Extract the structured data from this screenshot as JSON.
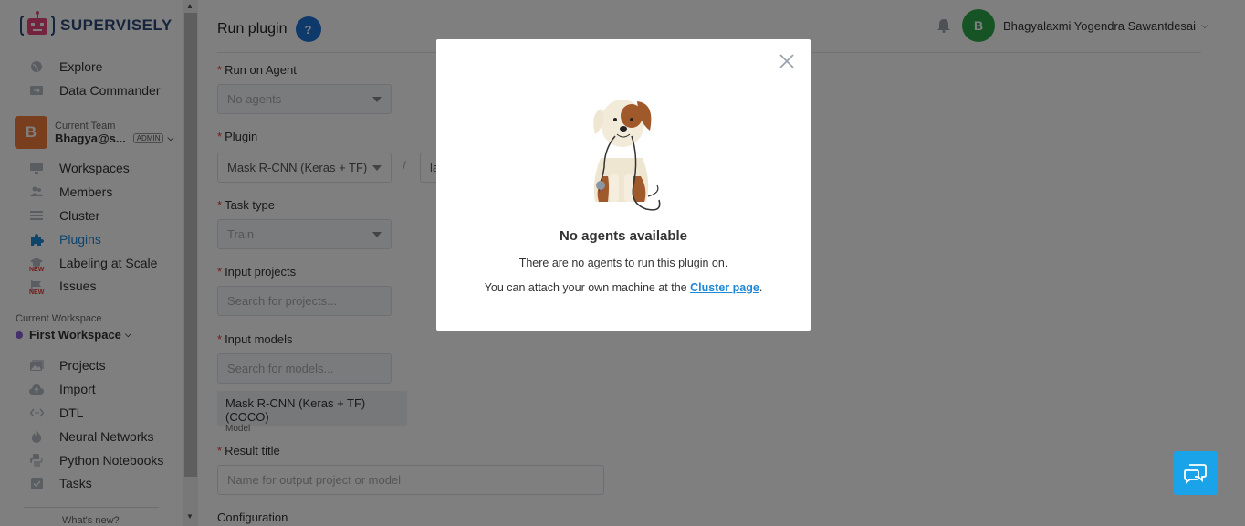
{
  "brand": {
    "name": "SUPERVISELY"
  },
  "sidebar": {
    "top_items": [
      {
        "label": "Explore",
        "icon": "globe-icon"
      },
      {
        "label": "Data Commander",
        "icon": "folder-transfer-icon"
      }
    ],
    "team": {
      "label": "Current Team",
      "name": "Bhagya@s...",
      "role": "ADMIN",
      "avatar_letter": "B"
    },
    "team_items": [
      {
        "label": "Workspaces",
        "icon": "monitor-icon"
      },
      {
        "label": "Members",
        "icon": "users-icon"
      },
      {
        "label": "Cluster",
        "icon": "list-icon"
      },
      {
        "label": "Plugins",
        "icon": "puzzle-icon",
        "active": true
      },
      {
        "label": "Labeling at Scale",
        "icon": "graduation-icon",
        "badge": "NEW"
      },
      {
        "label": "Issues",
        "icon": "flag-icon",
        "badge": "NEW"
      }
    ],
    "workspace": {
      "label": "Current Workspace",
      "name": "First Workspace"
    },
    "workspace_items": [
      {
        "label": "Projects",
        "icon": "images-icon"
      },
      {
        "label": "Import",
        "icon": "cloud-upload-icon"
      },
      {
        "label": "DTL",
        "icon": "code-icon"
      },
      {
        "label": "Neural Networks",
        "icon": "brain-icon"
      },
      {
        "label": "Python Notebooks",
        "icon": "notebook-icon"
      },
      {
        "label": "Tasks",
        "icon": "checkbox-icon"
      }
    ],
    "whats_new": "What's new?"
  },
  "header": {
    "title": "Run plugin",
    "help": "?",
    "user": {
      "avatar_letter": "B",
      "name": "Bhagyalaxmi Yogendra Sawantdesai"
    }
  },
  "form": {
    "agent": {
      "label": "Run on Agent",
      "value": "No agents"
    },
    "plugin": {
      "label": "Plugin",
      "value": "Mask R-CNN (Keras + TF)",
      "version_partial": "la"
    },
    "task_type": {
      "label": "Task type",
      "value": "Train"
    },
    "input_projects": {
      "label": "Input projects",
      "placeholder": "Search for projects..."
    },
    "input_models": {
      "label": "Input models",
      "placeholder": "Search for models...",
      "chip": {
        "name": "Mask R-CNN (Keras + TF) (COCO)",
        "type": "Model"
      }
    },
    "result_title": {
      "label": "Result title",
      "placeholder": "Name for output project or model"
    },
    "configuration": {
      "label": "Configuration"
    }
  },
  "modal": {
    "title": "No agents available",
    "line1": "There are no agents to run this plugin on.",
    "line2_prefix": "You can attach your own machine at the ",
    "link": "Cluster page",
    "line2_suffix": "."
  },
  "colors": {
    "accent": "#1e88d6",
    "team_avatar": "#f07d3a",
    "user_avatar": "#2ea84a",
    "chat": "#1aa3e8",
    "required": "#e53935"
  }
}
